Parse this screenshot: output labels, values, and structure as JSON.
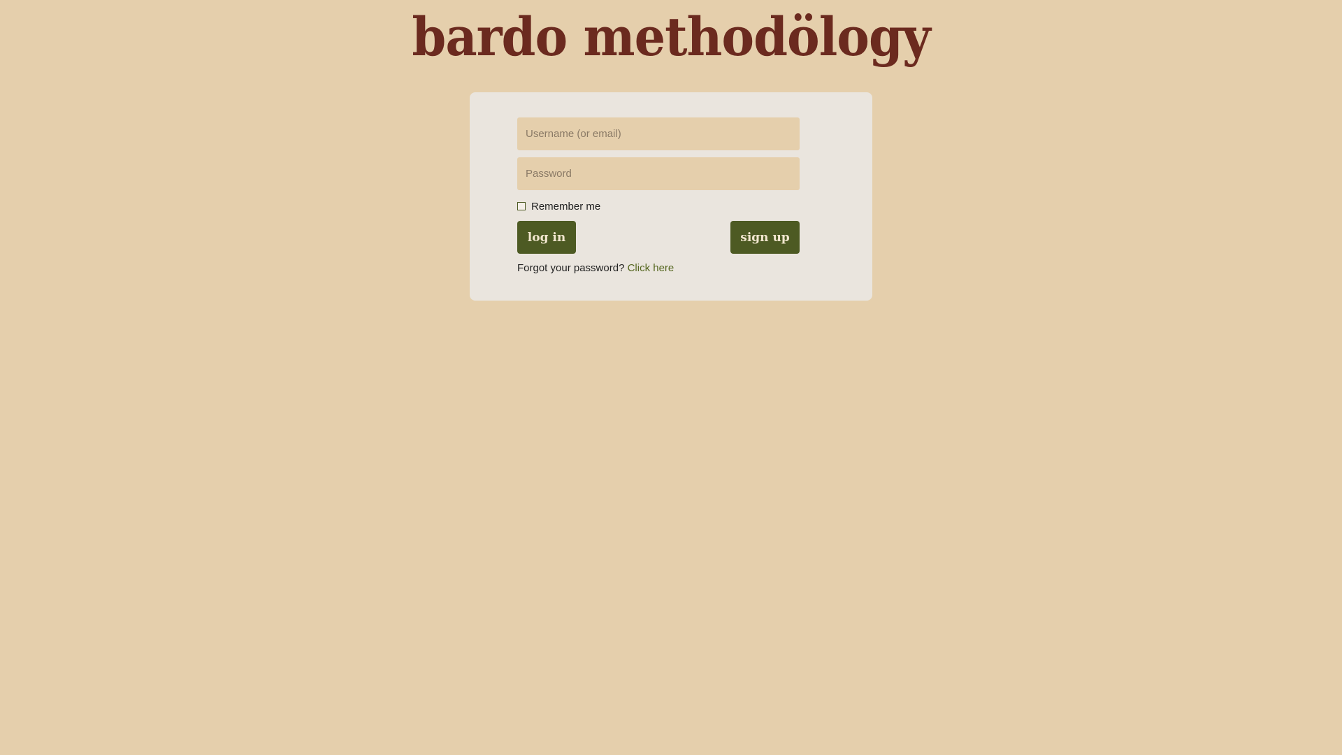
{
  "brand": {
    "logo_text": "bardo methodölogy"
  },
  "login_form": {
    "username_placeholder": "Username (or email)",
    "password_placeholder": "Password",
    "remember_label": "Remember me",
    "remember_checked": false,
    "login_label": "log in",
    "signup_label": "sign up",
    "forgot_text": "Forgot your password?",
    "forgot_link": "Click here"
  },
  "colors": {
    "background": "#e5cfac",
    "card": "#eae5de",
    "button": "#4d5a23",
    "logo": "#6b2a1f",
    "link": "#55661f"
  }
}
